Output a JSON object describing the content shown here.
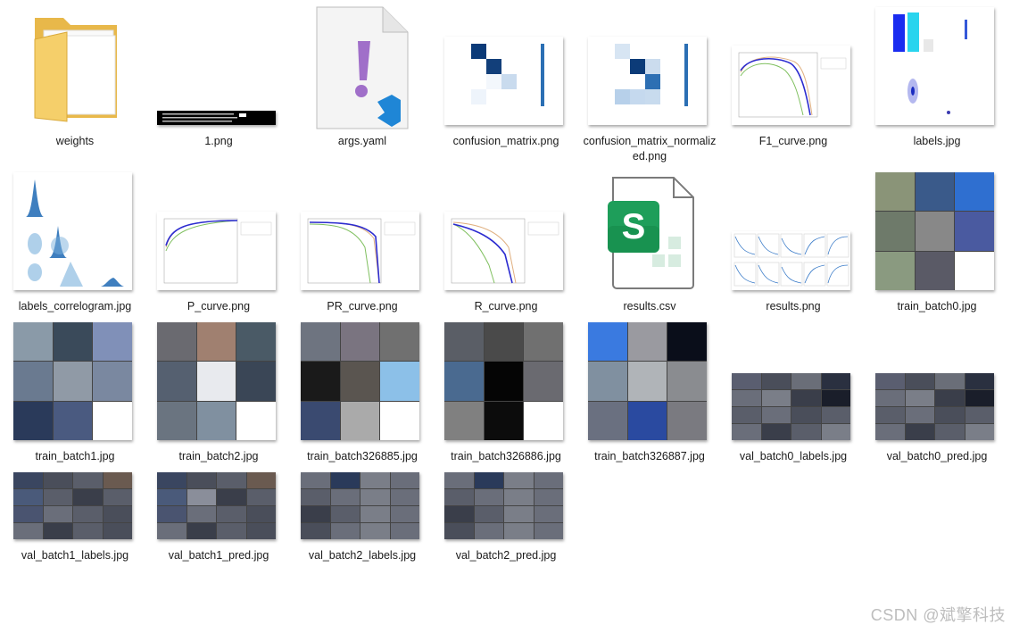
{
  "files": {
    "weights": "weights",
    "png1": "1.png",
    "args": "args.yaml",
    "cm": "confusion_matrix.png",
    "cmn": "confusion_matrix_normalized.png",
    "f1": "F1_curve.png",
    "labels": "labels.jpg",
    "corr": "labels_correlogram.jpg",
    "p": "P_curve.png",
    "pr": "PR_curve.png",
    "r": "R_curve.png",
    "csv": "results.csv",
    "results": "results.png",
    "tb0": "train_batch0.jpg",
    "tb1": "train_batch1.jpg",
    "tb2": "train_batch2.jpg",
    "tb885": "train_batch326885.jpg",
    "tb886": "train_batch326886.jpg",
    "tb887": "train_batch326887.jpg",
    "vb0l": "val_batch0_labels.jpg",
    "vb0p": "val_batch0_pred.jpg",
    "vb1l": "val_batch1_labels.jpg",
    "vb1p": "val_batch1_pred.jpg",
    "vb2l": "val_batch2_labels.jpg",
    "vb2p": "val_batch2_pred.jpg"
  },
  "watermark": "CSDN @斌擎科技",
  "icons": {
    "folder": "folder-icon",
    "yaml": "vscode-yaml-file-icon",
    "csv": "spreadsheet-csv-file-icon"
  }
}
